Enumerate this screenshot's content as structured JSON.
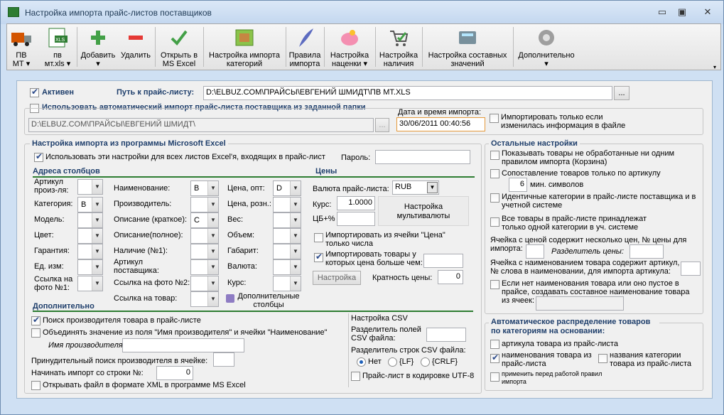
{
  "window": {
    "title": "Настройка импорта прайс-листов поставщиков",
    "controls": {
      "minimize": "▭",
      "restore": "▣",
      "close": "✕"
    }
  },
  "toolbar": {
    "buttons": [
      {
        "l1": "ПВ",
        "l2": "МТ ▾",
        "icon": "truck-icon"
      },
      {
        "l1": "пв",
        "l2": "мт.xls ▾",
        "icon": "xls-icon"
      },
      {
        "l1": "Добавить",
        "l2": "▾",
        "icon": "plus-icon"
      },
      {
        "l1": "Удалить",
        "l2": "",
        "icon": "minus-icon"
      },
      {
        "l1": "Открыть в",
        "l2": "MS Excel",
        "icon": "check-icon"
      },
      {
        "l1": "Настройка импорта",
        "l2": "категорий",
        "icon": "tree-icon"
      },
      {
        "l1": "Правила",
        "l2": "импорта",
        "icon": "feather-icon"
      },
      {
        "l1": "Настройка",
        "l2": "наценки ▾",
        "icon": "piggy-icon"
      },
      {
        "l1": "Настройка",
        "l2": "наличия",
        "icon": "cart-icon"
      },
      {
        "l1": "Настройка составных",
        "l2": "значений",
        "icon": "calc-icon"
      },
      {
        "l1": "Дополнительно",
        "l2": "▾",
        "icon": "gear-icon"
      }
    ]
  },
  "top": {
    "active_label": "Активен",
    "path_label": "Путь к прайс-листу:",
    "path_value": "D:\\ELBUZ.COM\\ПРАЙСЫ\\ЕВГЕНИЙ ШМИДТ\\ПВ МТ.XLS",
    "browse": "...",
    "auto_label": "Использовать автоматический импорт прайс-листа поставщика из заданной папки",
    "folder_value": "D:\\ELBUZ.COM\\ПРАЙСЫ\\ЕВГЕНИЙ ШМИДТ\\",
    "date_label": "Дата и время импорта:",
    "date_value": "30/06/2011 00:40:56",
    "only_changed": "Импортировать только если изменилась информация в файле"
  },
  "excel": {
    "title": "Настройка импорта из программы Microsoft Excel",
    "all_sheets": "Использовать эти настройки для всех листов Excel'я, входящих в прайс-лист",
    "password_label": "Пароль:"
  },
  "columns": {
    "title": "Адреса столбцов",
    "articul": "Артикул произ-ля:",
    "category": "Категория:",
    "category_val": "B",
    "model": "Модель:",
    "color": "Цвет:",
    "warranty": "Гарантия:",
    "unit": "Ед. изм:",
    "photo1": "Ссылка на фото №1:",
    "name": "Наименование:",
    "name_val": "B",
    "manufacturer": "Производитель:",
    "desc_short": "Описание (краткое):",
    "desc_short_val": "C",
    "desc_full": "Описание(полное):",
    "avail": "Наличие (№1):",
    "sup_articul": "Артикул поставщика:",
    "photo2": "Ссылка на фото №2:",
    "product_link": "Ссылка на товар:",
    "price_opt": "Цена, опт:",
    "price_opt_val": "D",
    "price_retail": "Цена, розн.:",
    "weight": "Вес:",
    "volume": "Объем:",
    "size": "Габарит:",
    "currency": "Валюта:",
    "rate": "Курс:",
    "extra_cols": "Дополнительные столбцы"
  },
  "prices": {
    "title": "Цены",
    "currency_label": "Валюта прайс-листа:",
    "currency_val": "RUB",
    "rate_label": "Курс:",
    "rate_val": "1.0000",
    "cb_label": "ЦБ+%",
    "multi_btn": "Настройка мультивалюты",
    "import_price_cell": "Импортировать из ячейки \"Цена\" только числа",
    "import_greater": "Импортировать товары у которых цена больше чем:",
    "settings_btn": "Настройка",
    "multiplicity_label": "Кратность цены:",
    "multiplicity_val": "0"
  },
  "additional": {
    "title": "Дополнительно",
    "search_manufacturer": "Поиск производителя товара в прайс-листе",
    "merge": "Объединять значение из поля \"Имя производителя\" и ячейки \"Наименование\"",
    "manufacturer_name": "Имя производителя:",
    "forced_search": "Принудительный поиск производителя в ячейке:",
    "start_row_label": "Начинать импорт со строки №:",
    "start_row_val": "0",
    "open_xml": "Открывать файл в формате XML в программе MS Excel"
  },
  "csv": {
    "title": "Настройка CSV",
    "field_sep": "Разделитель полей CSV файла:",
    "row_sep": "Разделитель строк CSV файла:",
    "opt_none": "Нет",
    "opt_lf": "{LF}",
    "opt_crlf": "{CRLF}",
    "utf8": "Прайс-лист в кодировке UTF-8"
  },
  "other": {
    "title": "Остальные настройки",
    "show_unprocessed": "Показывать товары не обработанные ни одним правилом импорта (Корзина)",
    "match_articul": "Сопоставление товаров только по артикулу",
    "min_chars_val": "6",
    "min_chars_label": "мин. символов",
    "identical_cats": "Идентичные категории в прайс-листе поставщика и в учетной системе",
    "one_category": "Все товары в прайс-листе принадлежат только одной категории в уч. системе",
    "multi_price": "Ячейка с ценой содержит несколько цен, № цены для импорта:",
    "price_sep": "Разделитель цены:",
    "word_num": "Ячейка с наименованием товара содержит артикул, № слова в наименовании, для импорта артикула:",
    "composite": "Если нет наименования товара или оно пустое в прайсе, создавать составное наименование товара из ячеек:"
  },
  "autodist": {
    "title": "Автоматическое распределение товаров по категориям на основании:",
    "by_articul": "артикула товара из прайс-листа",
    "by_name": "наименования товара из прайс-листа",
    "by_catname": "названия категории товара из прайс-листа",
    "apply_before": "применить перед работой правил импорта"
  }
}
